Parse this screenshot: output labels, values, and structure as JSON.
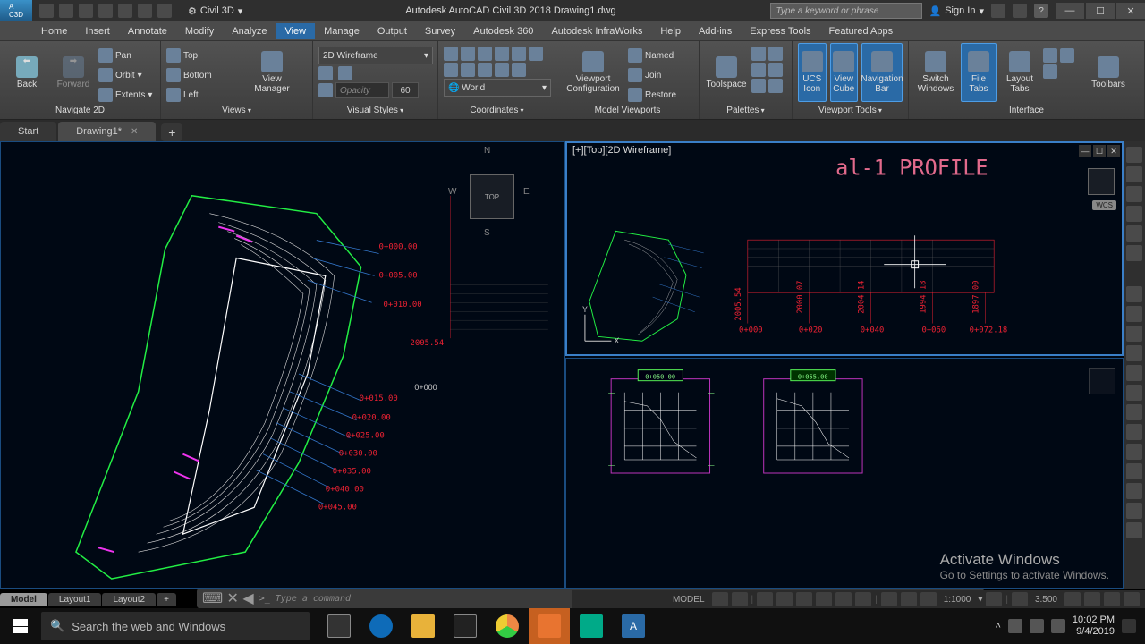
{
  "app": {
    "workspace": "Civil 3D",
    "title": "Autodesk AutoCAD Civil 3D 2018  Drawing1.dwg",
    "search_placeholder": "Type a keyword or phrase",
    "signin": "Sign In"
  },
  "menu": [
    "Home",
    "Insert",
    "Annotate",
    "Modify",
    "Analyze",
    "View",
    "Manage",
    "Output",
    "Survey",
    "Autodesk 360",
    "Autodesk InfraWorks",
    "Help",
    "Add-ins",
    "Express Tools",
    "Featured Apps"
  ],
  "active_menu": "View",
  "ribbon": {
    "nav": {
      "back": "Back",
      "forward": "Forward",
      "pan": "Pan",
      "orbit": "Orbit",
      "extents": "Extents",
      "label": "Navigate 2D"
    },
    "views": {
      "top": "Top",
      "bottom": "Bottom",
      "left": "Left",
      "mgr": "View\nManager",
      "label": "Views"
    },
    "visual": {
      "style": "2D Wireframe",
      "opacity": "Opacity",
      "opval": "60",
      "label": "Visual Styles"
    },
    "coords": {
      "world": "World",
      "label": "Coordinates"
    },
    "viewports": {
      "cfg": "Viewport\nConfiguration",
      "named": "Named",
      "join": "Join",
      "restore": "Restore",
      "label": "Model Viewports"
    },
    "palettes": {
      "toolspace": "Toolspace",
      "label": "Palettes"
    },
    "vptools": {
      "ucs": "UCS\nIcon",
      "cube": "View\nCube",
      "nav": "Navigation\nBar",
      "label": "Viewport Tools"
    },
    "interface": {
      "switch": "Switch\nWindows",
      "ftabs": "File\nTabs",
      "ltabs": "Layout\nTabs",
      "toolbars": "Toolbars",
      "label": "Interface"
    }
  },
  "filetabs": {
    "start": "Start",
    "drawing": "Drawing1*"
  },
  "viewport2_label": "[+][Top][2D Wireframe]",
  "profile_title": "al-1 PROFILE",
  "stations": [
    "0+000.00",
    "0+005.00",
    "0+010.00",
    "0+015.00",
    "0+020.00",
    "0+025.00",
    "0+030.00",
    "0+035.00",
    "0+040.00",
    "0+045.00"
  ],
  "elev_label": "2005.54",
  "origin_label": "0+000",
  "profile_stations": [
    "0+000",
    "0+020",
    "0+040",
    "0+060",
    "0+072.18"
  ],
  "profile_elevs": [
    "2005.54",
    "2000.07",
    "2004.14",
    "1994.18",
    "1897.00"
  ],
  "section_label1": "0+050.00",
  "section_label2": "0+055.00",
  "wcs": "WCS",
  "compass": {
    "n": "N",
    "s": "S",
    "e": "E",
    "w": "W",
    "top": "TOP"
  },
  "command": {
    "prompt": ">_",
    "placeholder": "Type a command"
  },
  "layout_tabs": [
    "Model",
    "Layout1",
    "Layout2"
  ],
  "status": {
    "model": "MODEL",
    "scale": "1:1000",
    "val": "3.500"
  },
  "watermark": {
    "t1": "Activate Windows",
    "t2": "Go to Settings to activate Windows."
  },
  "taskbar": {
    "search": "Search the web and Windows",
    "time": "10:02 PM",
    "date": "9/4/2019"
  }
}
